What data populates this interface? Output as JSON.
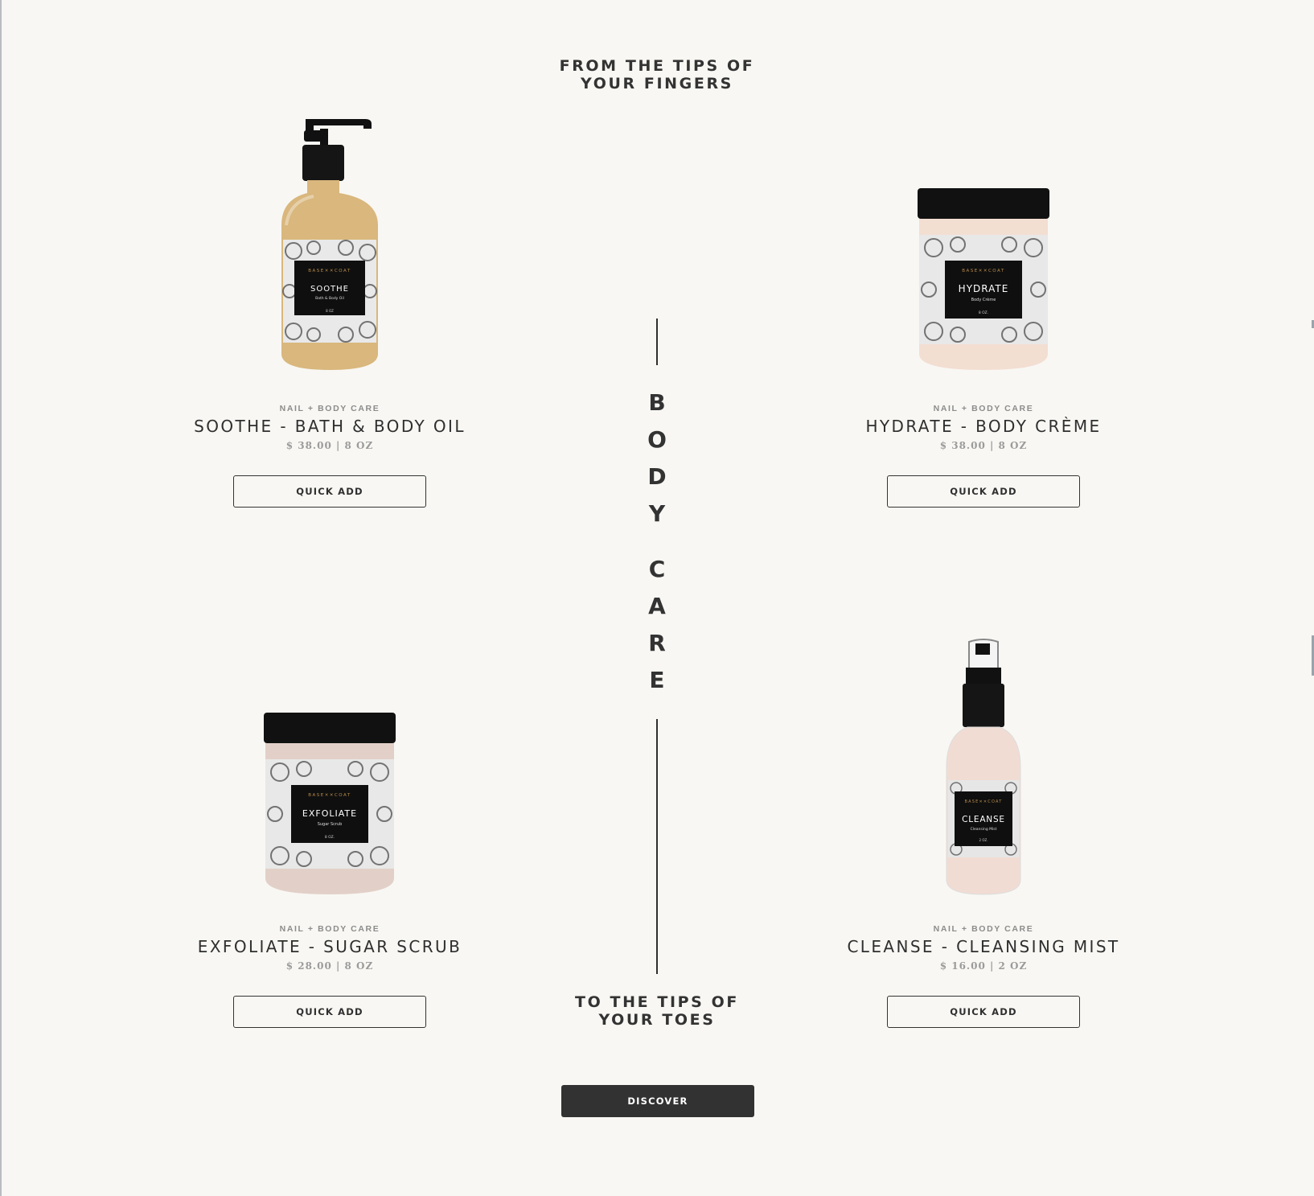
{
  "taglines": {
    "top": [
      "FROM THE TIPS OF",
      "YOUR FINGERS"
    ],
    "bottom": [
      "TO THE TIPS OF",
      "YOUR TOES"
    ]
  },
  "section_title": {
    "letters": [
      "B",
      "O",
      "D",
      "Y",
      "C",
      "A",
      "R",
      "E"
    ]
  },
  "products": [
    {
      "category": "NAIL + BODY CARE",
      "name": "SOOTHE - BATH & BODY OIL",
      "price": "$ 38.00 | 8 OZ",
      "button": "QUICK ADD",
      "image": {
        "kind": "pump-bottle",
        "brand": "BASE✕✕COAT",
        "label": "SOOTHE",
        "sublabel": "Bath & Body Oil",
        "size": "8 OZ",
        "liquid": "#d9b77d"
      }
    },
    {
      "category": "NAIL + BODY CARE",
      "name": "HYDRATE - BODY CRÈME",
      "price": "$ 38.00 | 8 OZ",
      "button": "QUICK ADD",
      "image": {
        "kind": "jar",
        "brand": "BASE✕✕COAT",
        "label": "HYDRATE",
        "sublabel": "Body Crème",
        "size": "8 OZ.",
        "liquid": "#f3ded2"
      }
    },
    {
      "category": "NAIL + BODY CARE",
      "name": "EXFOLIATE - SUGAR SCRUB",
      "price": "$ 28.00 | 8 OZ",
      "button": "QUICK ADD",
      "image": {
        "kind": "jar",
        "brand": "BASE✕✕COAT",
        "label": "EXFOLIATE",
        "sublabel": "Sugar Scrub",
        "size": "8 OZ.",
        "liquid": "#e2d0c8"
      }
    },
    {
      "category": "NAIL + BODY CARE",
      "name": "CLEANSE - CLEANSING MIST",
      "price": "$ 16.00 | 2 OZ",
      "button": "QUICK ADD",
      "image": {
        "kind": "spray-bottle",
        "brand": "BASE✕✕COAT",
        "label": "CLEANSE",
        "sublabel": "Cleansing Mist",
        "size": "2 OZ.",
        "liquid": "#f1dcd3"
      }
    }
  ],
  "cta": {
    "label": "DISCOVER"
  },
  "colors": {
    "background": "#f8f7f3",
    "text": "#2f2f2f",
    "button_dark": "#323232",
    "muted": "#8c8c8c"
  }
}
